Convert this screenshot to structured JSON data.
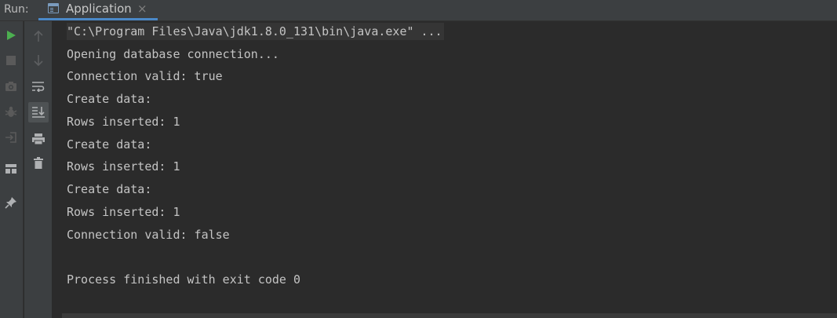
{
  "header": {
    "run_label": "Run:",
    "tab_title": "Application",
    "tab_close": "×"
  },
  "toolbar_left": [
    {
      "name": "rerun-icon",
      "color": "#4caf50"
    },
    {
      "name": "stop-icon",
      "color": "#5a5a5a"
    },
    {
      "name": "camera-icon",
      "color": "#5a5a5a"
    },
    {
      "name": "debug-icon",
      "color": "#5a5a5a"
    },
    {
      "name": "login-icon",
      "color": "#5a5a5a"
    },
    {
      "name": "layout-icon",
      "color": "#afb1b3"
    },
    {
      "name": "pin-icon",
      "color": "#afb1b3"
    }
  ],
  "toolbar_right": [
    {
      "name": "arrow-up-icon"
    },
    {
      "name": "arrow-down-icon"
    },
    {
      "name": "soft-wrap-icon"
    },
    {
      "name": "scroll-to-end-icon",
      "selected": true
    },
    {
      "name": "print-icon"
    },
    {
      "name": "trash-icon"
    }
  ],
  "console": {
    "lines": [
      "\"C:\\Program Files\\Java\\jdk1.8.0_131\\bin\\java.exe\" ...",
      "Opening database connection...",
      "Connection valid: true",
      "Create data:",
      "Rows inserted: 1",
      "Create data:",
      "Rows inserted: 1",
      "Create data:",
      "Rows inserted: 1",
      "Connection valid: false",
      "",
      "Process finished with exit code 0"
    ],
    "text_color": "#c4c4c4",
    "background": "#2b2b2b"
  }
}
